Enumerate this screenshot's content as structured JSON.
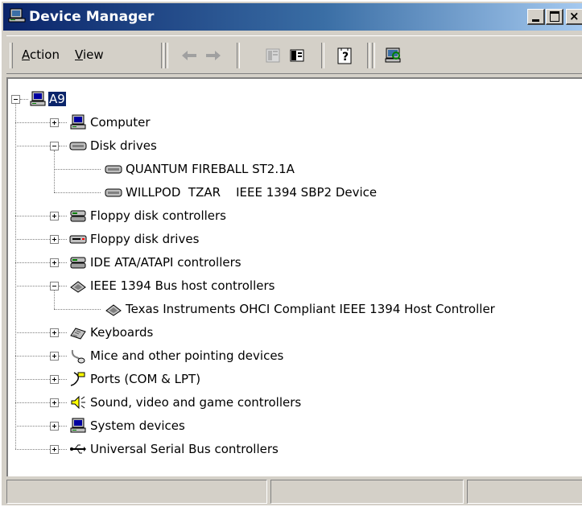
{
  "window": {
    "title": "Device Manager",
    "icon": "computer-icon"
  },
  "toolbar": {
    "menus": [
      {
        "label": "Action",
        "accel": "A",
        "rest": "ction"
      },
      {
        "label": "View",
        "accel": "V",
        "rest": "iew"
      }
    ],
    "buttons": [
      "back-arrow-icon",
      "forward-arrow-icon",
      "properties-icon",
      "show-hide-tree-icon",
      "help-icon",
      "scan-hardware-icon"
    ]
  },
  "tree": {
    "root": "A9",
    "categories": [
      {
        "label": "Computer",
        "expanded": false,
        "icon": "computer-icon"
      },
      {
        "label": "Disk drives",
        "expanded": true,
        "icon": "disk-drive-icon",
        "children": [
          "QUANTUM FIREBALL ST2.1A",
          "WILLPOD  TZAR    IEEE 1394 SBP2 Device"
        ]
      },
      {
        "label": "Floppy disk controllers",
        "expanded": false,
        "icon": "controller-icon"
      },
      {
        "label": "Floppy disk drives",
        "expanded": false,
        "icon": "floppy-drive-icon"
      },
      {
        "label": "IDE ATA/ATAPI controllers",
        "expanded": false,
        "icon": "controller-icon"
      },
      {
        "label": "IEEE 1394 Bus host controllers",
        "expanded": true,
        "icon": "ieee1394-icon",
        "children": [
          "Texas Instruments OHCI Compliant IEEE 1394 Host Controller"
        ]
      },
      {
        "label": "Keyboards",
        "expanded": false,
        "icon": "keyboard-icon"
      },
      {
        "label": "Mice and other pointing devices",
        "expanded": false,
        "icon": "mouse-icon"
      },
      {
        "label": "Ports (COM & LPT)",
        "expanded": false,
        "icon": "port-icon"
      },
      {
        "label": "Sound, video and game controllers",
        "expanded": false,
        "icon": "speaker-icon"
      },
      {
        "label": "System devices",
        "expanded": false,
        "icon": "computer-icon"
      },
      {
        "label": "Universal Serial Bus controllers",
        "expanded": false,
        "icon": "usb-icon"
      }
    ]
  },
  "statusbar": {
    "panels": [
      "",
      "",
      ""
    ]
  }
}
